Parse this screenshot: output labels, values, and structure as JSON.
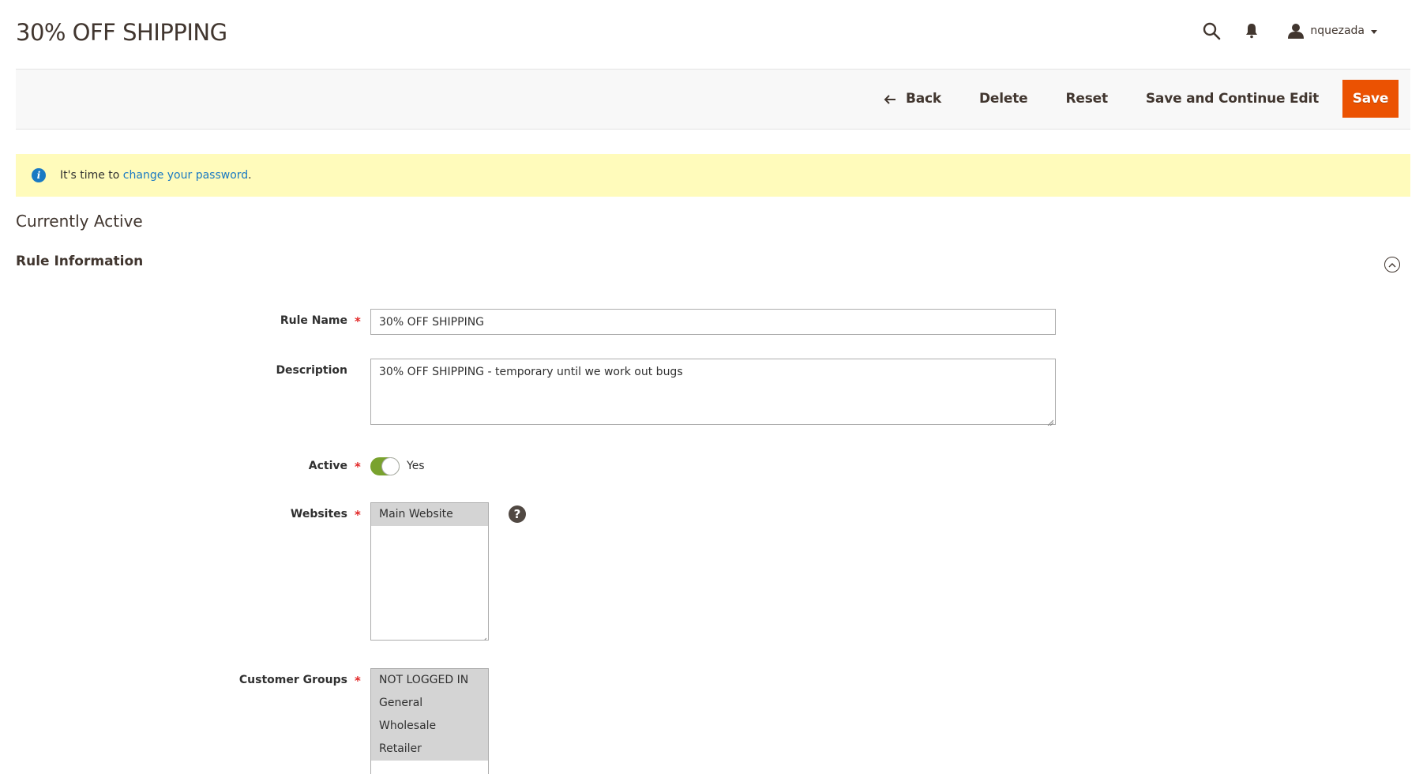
{
  "page": {
    "title": "30% OFF SHIPPING"
  },
  "header": {
    "icons": [
      "search-icon",
      "bell-icon",
      "user-icon"
    ],
    "username": "nquezada"
  },
  "toolbar": {
    "back_label": "Back",
    "delete_label": "Delete",
    "reset_label": "Reset",
    "save_continue_label": "Save and Continue Edit",
    "save_label": "Save",
    "accent_color": "#eb5202"
  },
  "notice": {
    "prefix": "It's time to ",
    "link_text": "change your password",
    "suffix": "."
  },
  "status_heading": "Currently Active",
  "section": {
    "title": "Rule Information"
  },
  "form": {
    "rule_name": {
      "label": "Rule Name",
      "required": "*",
      "value": "30% OFF SHIPPING"
    },
    "description": {
      "label": "Description",
      "value": "30% OFF SHIPPING - temporary until we work out bugs"
    },
    "active": {
      "label": "Active",
      "required": "*",
      "value_label": "Yes",
      "on": true,
      "color": "#79a22e"
    },
    "websites": {
      "label": "Websites",
      "required": "*",
      "options": [
        "Main Website"
      ],
      "help": "?"
    },
    "customer_groups": {
      "label": "Customer Groups",
      "required": "*",
      "options": [
        "NOT LOGGED IN",
        "General",
        "Wholesale",
        "Retailer"
      ]
    }
  }
}
